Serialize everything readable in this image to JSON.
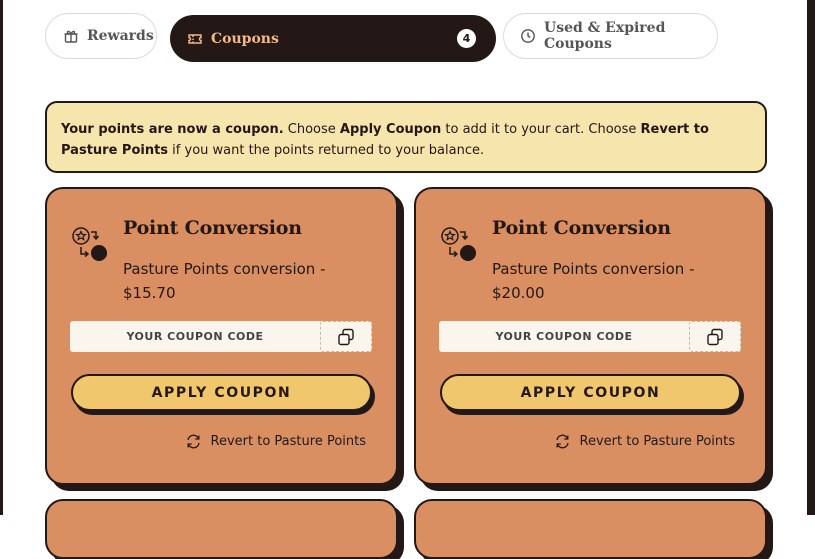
{
  "tabs": {
    "rewards": {
      "label": "Rewards",
      "icon": "gift-icon"
    },
    "coupons": {
      "label": "Coupons",
      "count": "4",
      "icon": "ticket-icon",
      "active": true
    },
    "used": {
      "label": "Used & Expired Coupons",
      "icon": "clock-icon"
    }
  },
  "notice": {
    "part1_bold": "Your points are now a coupon.",
    "part2": " Choose ",
    "part3_bold": "Apply Coupon",
    "part4": " to add it to your cart. Choose ",
    "part5_bold": "Revert to Pasture Points",
    "part6": " if you want the points returned to your balance."
  },
  "cards": [
    {
      "title": "Point Conversion",
      "description": "Pasture Points conversion - $15.70",
      "code_placeholder": "YOUR COUPON CODE",
      "apply_label": "APPLY COUPON",
      "revert_label": "Revert to Pasture Points"
    },
    {
      "title": "Point Conversion",
      "description": "Pasture Points conversion - $20.00",
      "code_placeholder": "YOUR COUPON CODE",
      "apply_label": "APPLY COUPON",
      "revert_label": "Revert to Pasture Points"
    }
  ],
  "colors": {
    "dark": "#231815",
    "card_bg": "#d98f62",
    "notice_bg": "#f7e5ae",
    "button_bg": "#f0c76c",
    "active_tab_text": "#f2b987"
  }
}
